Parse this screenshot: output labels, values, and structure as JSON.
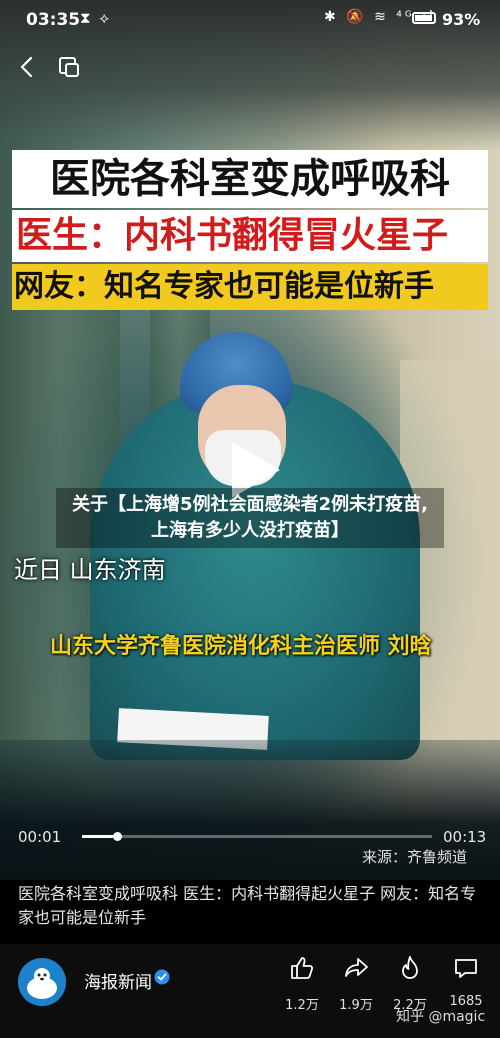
{
  "status_bar": {
    "time": "03:35",
    "left_icons": "⧗ ⟡",
    "right_icons": "✱ 🔕 ≋ ⁴ᴳ ıl",
    "battery": "93%"
  },
  "banners": {
    "line1": "医院各科室变成呼吸科",
    "line2": "医生：内科书翻得冒火星子",
    "line3": "网友：知名专家也可能是位新手"
  },
  "video": {
    "title_overlay": "关于【上海增5例社会面感染者2例未打疫苗,上海有多少人没打疫苗】",
    "place_caption": "近日 山东济南",
    "doctor_caption": "山东大学齐鲁医院消化科主治医师 刘晗",
    "current_time": "00:01",
    "total_time": "00:13",
    "progress": 0.1,
    "source": "来源：齐鲁频道"
  },
  "description": "医院各科室变成呼吸科 医生：内科书翻得起火星子 网友：知名专家也可能是位新手",
  "author": {
    "name": "海报新闻",
    "verified": true
  },
  "actions": {
    "like_count": "1.2万",
    "share_count": "1.9万",
    "fire_count": "2.2万",
    "comment_count": "1685"
  },
  "watermark": "知乎 @magic",
  "icons": [
    "back-icon",
    "window-icon",
    "play-icon",
    "verified-icon",
    "like-icon",
    "share-icon",
    "fire-icon",
    "comment-icon"
  ]
}
